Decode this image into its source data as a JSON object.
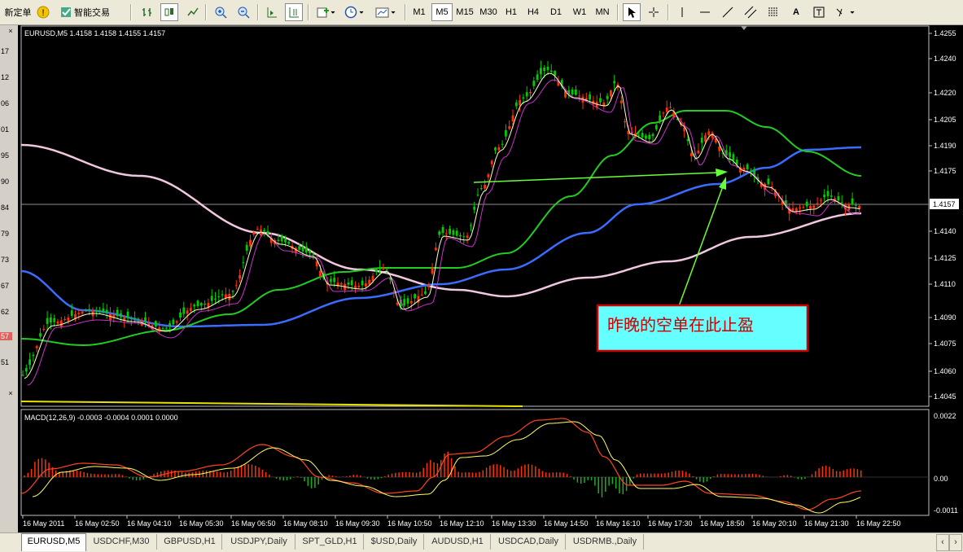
{
  "toolbar": {
    "new_order": "新定单",
    "expert_advisors": "智能交易",
    "timeframes": [
      "M1",
      "M5",
      "M15",
      "M30",
      "H1",
      "H4",
      "D1",
      "W1",
      "MN"
    ],
    "active_timeframe": "M5",
    "label_tool": "A"
  },
  "chart": {
    "info": "EURUSD,M5  1.4158 1.4158 1.4155 1.4157",
    "price_axis": [
      "1.4255",
      "1.4240",
      "1.4220",
      "1.4205",
      "1.4190",
      "1.4175",
      "1.4140",
      "1.4125",
      "1.4110",
      "1.4090",
      "1.4075",
      "1.4060",
      "1.4045"
    ],
    "current_price": "1.4157",
    "left_scale": [
      "17",
      "12",
      "06",
      "01",
      "95",
      "90",
      "84",
      "79",
      "73",
      "67",
      "62",
      "57",
      "51"
    ],
    "annotation": "昨晚的空单在此止盈"
  },
  "macd": {
    "info": "MACD(12,26,9) -0.0003 -0.0004 0.0001 0.0000",
    "axis": [
      "0.0022",
      "0.00",
      "-0.0011"
    ]
  },
  "time_axis": [
    "16 May 2011",
    "16 May 02:50",
    "16 May 04:10",
    "16 May 05:30",
    "16 May 06:50",
    "16 May 08:10",
    "16 May 09:30",
    "16 May 10:50",
    "16 May 12:10",
    "16 May 13:30",
    "16 May 14:50",
    "16 May 16:10",
    "16 May 17:30",
    "16 May 18:50",
    "16 May 20:10",
    "16 May 21:30",
    "16 May 22:50"
  ],
  "tabs": [
    "EURUSD,M5",
    "USDCHF,M30",
    "GBPUSD,H1",
    "USDJPY,Daily",
    "SPT_GLD,H1",
    "$USD,Daily",
    "AUDUSD,H1",
    "USDCAD,Daily",
    "USDRMB.,Daily"
  ],
  "active_tab": "EURUSD,M5",
  "colors": {
    "background": "#000000",
    "bull_candle": "#ff3300",
    "bear_candle": "#00cc00",
    "ma_green": "#22cc22",
    "ma_blue": "#3366ff",
    "ma_pink": "#f0c8e0",
    "ma_magenta": "#cc33cc",
    "ma_white": "#ffffcc",
    "arrow": "#66ff33",
    "annotation_bg": "#66ffff",
    "annotation_text": "#cc0000"
  }
}
